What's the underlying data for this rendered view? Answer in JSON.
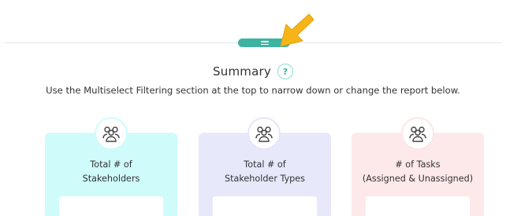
{
  "summary": {
    "title": "Summary",
    "help_icon": "?",
    "subtitle": "Use the Multiselect Filtering section at the top to narrow down or change the report below."
  },
  "cards": [
    {
      "icon": "people-group-icon",
      "label_line1": "Total # of",
      "label_line2": "Stakeholders",
      "color": "#cffbfb"
    },
    {
      "icon": "people-group-icon",
      "label_line1": "Total # of",
      "label_line2": "Stakeholder Types",
      "color": "#e7e9fb"
    },
    {
      "icon": "people-group-icon",
      "label_line1": "# of Tasks",
      "label_line2": "(Assigned & Unassigned)",
      "color": "#fde9ea"
    }
  ],
  "colors": {
    "accent": "#3db3a0",
    "arrow": "#f6b417"
  }
}
